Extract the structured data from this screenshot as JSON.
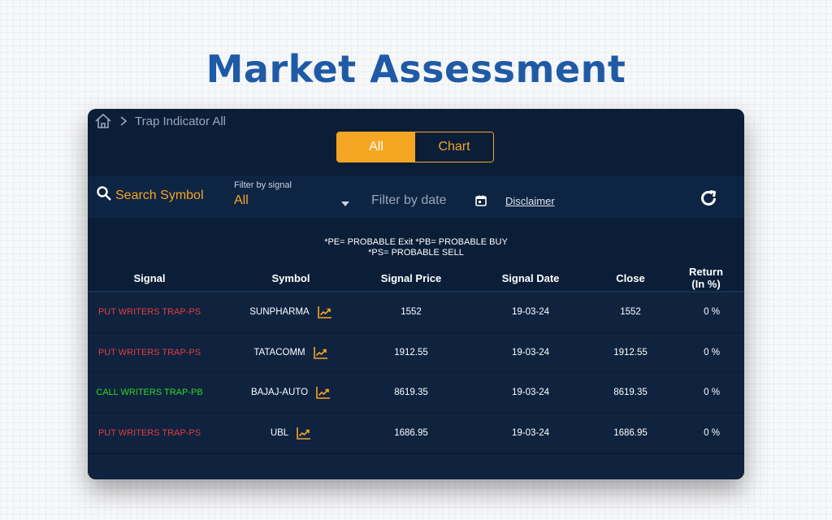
{
  "page": {
    "heading": "Market Assessment"
  },
  "breadcrumb": {
    "home_icon": "home-icon",
    "separator_icon": "chevron-right-icon",
    "current": "Trap Indicator All"
  },
  "view_toggle": {
    "options": [
      {
        "label": "All",
        "active": true
      },
      {
        "label": "Chart",
        "active": false
      }
    ]
  },
  "filters": {
    "search_label": "Search Symbol",
    "signal_filter_label": "Filter by signal",
    "signal_filter_value": "All",
    "date_filter_placeholder": "Filter by date",
    "disclaimer_label": "Disclaimer",
    "refresh_icon": "refresh-icon"
  },
  "notes": {
    "line1": "*PE= PROBABLE Exit  *PB= PROBABLE BUY",
    "line2": "*PS= PROBABLE SELL"
  },
  "table": {
    "headers": {
      "signal": "Signal",
      "symbol": "Symbol",
      "signal_price": "Signal Price",
      "signal_date": "Signal Date",
      "close": "Close",
      "return_l1": "Return",
      "return_l2": "(In %)"
    },
    "rows": [
      {
        "signal": "PUT WRITERS TRAP-PS",
        "signal_color": "#e23b3b",
        "symbol": "SUNPHARMA",
        "signal_price": "1552",
        "signal_date": "19-03-24",
        "close": "1552",
        "return": "0 %"
      },
      {
        "signal": "PUT WRITERS TRAP-PS",
        "signal_color": "#e23b3b",
        "symbol": "TATACOMM",
        "signal_price": "1912.55",
        "signal_date": "19-03-24",
        "close": "1912.55",
        "return": "0 %"
      },
      {
        "signal": "CALL WRITERS TRAP-PB",
        "signal_color": "#33d321",
        "symbol": "BAJAJ-AUTO",
        "signal_price": "8619.35",
        "signal_date": "19-03-24",
        "close": "8619.35",
        "return": "0 %"
      },
      {
        "signal": "PUT WRITERS TRAP-PS",
        "signal_color": "#e23b3b",
        "symbol": "UBL",
        "signal_price": "1686.95",
        "signal_date": "19-03-24",
        "close": "1686.95",
        "return": "0 %"
      }
    ]
  },
  "colors": {
    "accent": "#f5a623",
    "panel_bg": "#0b1e37",
    "heading": "#1f5aa6"
  }
}
